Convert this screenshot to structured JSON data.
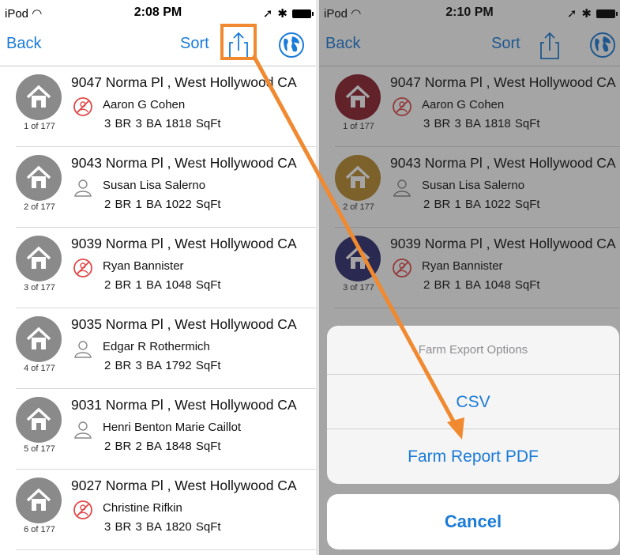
{
  "left": {
    "status": {
      "carrier": "iPod",
      "time": "2:08 PM"
    },
    "nav": {
      "back": "Back",
      "sort": "Sort"
    },
    "rows": [
      {
        "address": "9047 Norma Pl , West Hollywood CA",
        "owner": "Aaron G Cohen",
        "details": "3 BR  3 BA  1818 SqFt",
        "index": "1 of 177",
        "owner_icon": "no-contact-icon"
      },
      {
        "address": "9043 Norma Pl , West Hollywood CA",
        "owner": "Susan Lisa Salerno",
        "details": "2 BR  1 BA  1022 SqFt",
        "index": "2 of 177",
        "owner_icon": "person-icon"
      },
      {
        "address": "9039 Norma Pl , West Hollywood CA",
        "owner": "Ryan Bannister",
        "details": "2 BR  1 BA  1048 SqFt",
        "index": "3 of 177",
        "owner_icon": "no-contact-icon"
      },
      {
        "address": "9035 Norma Pl , West Hollywood CA",
        "owner": "Edgar R Rothermich",
        "details": "2 BR  3 BA  1792 SqFt",
        "index": "4 of 177",
        "owner_icon": "person-icon"
      },
      {
        "address": "9031 Norma Pl , West Hollywood CA",
        "owner": "Henri Benton Marie Caillot",
        "details": "2 BR  2 BA  1848 SqFt",
        "index": "5 of 177",
        "owner_icon": "person-icon"
      },
      {
        "address": "9027 Norma Pl , West Hollywood CA",
        "owner": "Christine Rifkin",
        "details": "3 BR  3 BA  1820 SqFt",
        "index": "6 of 177",
        "owner_icon": "no-contact-icon"
      }
    ]
  },
  "right": {
    "status": {
      "carrier": "iPod",
      "time": "2:10 PM"
    },
    "nav": {
      "back": "Back",
      "sort": "Sort"
    },
    "rows": [
      {
        "address": "9047 Norma Pl , West Hollywood CA",
        "owner": "Aaron G Cohen",
        "details": "3 BR  3 BA  1818 SqFt",
        "index": "1 of 177",
        "avatar_color": "#8b1e2b"
      },
      {
        "address": "9043 Norma Pl , West Hollywood CA",
        "owner": "Susan Lisa Salerno",
        "details": "2 BR  1 BA  1022 SqFt",
        "index": "2 of 177",
        "avatar_color": "#b88a2e"
      },
      {
        "address": "9039 Norma Pl , West Hollywood CA",
        "owner": "Ryan Bannister",
        "details": "2 BR  1 BA  1048 SqFt",
        "index": "3 of 177",
        "avatar_color": "#2b2a6e"
      }
    ],
    "sheet": {
      "title": "Farm Export Options",
      "options": [
        "CSV",
        "Farm Report PDF"
      ],
      "cancel": "Cancel"
    }
  },
  "colors": {
    "accent": "#1a7bd8",
    "annotation": "#f0892f",
    "avatar_gray": "#8a8a8a"
  }
}
